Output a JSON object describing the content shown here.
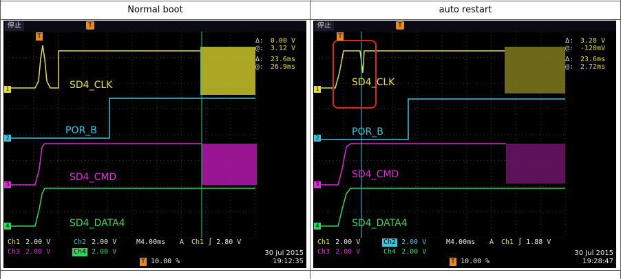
{
  "panels": [
    {
      "title": "Normal boot",
      "status": "停止",
      "measurements": {
        "v_delta_label": "Δ:",
        "v_delta": "0.00 V",
        "v_at_label": "@:",
        "v_at": "3.12 V",
        "t_delta_label": "Δ:",
        "t_delta": "23.6ms",
        "t_at_label": "@:",
        "t_at": "26.9ms"
      },
      "signals": {
        "clk": "SD4_CLK",
        "por": "POR_B",
        "cmd": "SD4_CMD",
        "data": "SD4_DATA4"
      },
      "bottom": {
        "ch1": "Ch1",
        "ch1_scale": "2.00 V",
        "ch2": "Ch2",
        "ch2_scale": "2.00 V",
        "ch3": "Ch3",
        "ch3_scale": "2.00 V",
        "ch4": "Ch4",
        "ch4_scale": "2.00 V",
        "timebase": "M4.00ms",
        "mode": "A",
        "trig_ch": "Ch1",
        "trig_sym": "∫",
        "trig_level": "2.80 V",
        "trig_pos": "10.00 %",
        "date": "30 Jul  2015",
        "time": "19:12:35"
      }
    },
    {
      "title": "auto   restart",
      "status": "停止",
      "measurements": {
        "v_delta_label": "Δ:",
        "v_delta": "3.28 V",
        "v_at_label": "@:",
        "v_at": "-120mV",
        "t_delta_label": "Δ:",
        "t_delta": "23.6ms",
        "t_at_label": "@:",
        "t_at": "2.72ms"
      },
      "signals": {
        "clk": "SD4_CLK",
        "por": "POR_B",
        "cmd": "SD4_CMD",
        "data": "SD4_DATA4"
      },
      "bottom": {
        "ch1": "Ch1",
        "ch1_scale": "2.00 V",
        "ch2": "Ch2",
        "ch2_scale": "2.00 V",
        "ch3": "Ch3",
        "ch3_scale": "2.00 V",
        "ch4": "Ch4",
        "ch4_scale": "2.00 V",
        "timebase": "M4.00ms",
        "mode": "A",
        "trig_ch": "Ch1",
        "trig_sym": "∫",
        "trig_level": "1.88 V",
        "trig_pos": "10.00 %",
        "date": "30 Jul  2015",
        "time": "19:28:47"
      }
    }
  ],
  "colors": {
    "ch1": "#e5e03a",
    "ch2": "#35c8e0",
    "ch3": "#e02ad8",
    "ch4": "#2fd85a",
    "trigger_marker": "#e58a1f",
    "highlight": "#e3221b"
  }
}
